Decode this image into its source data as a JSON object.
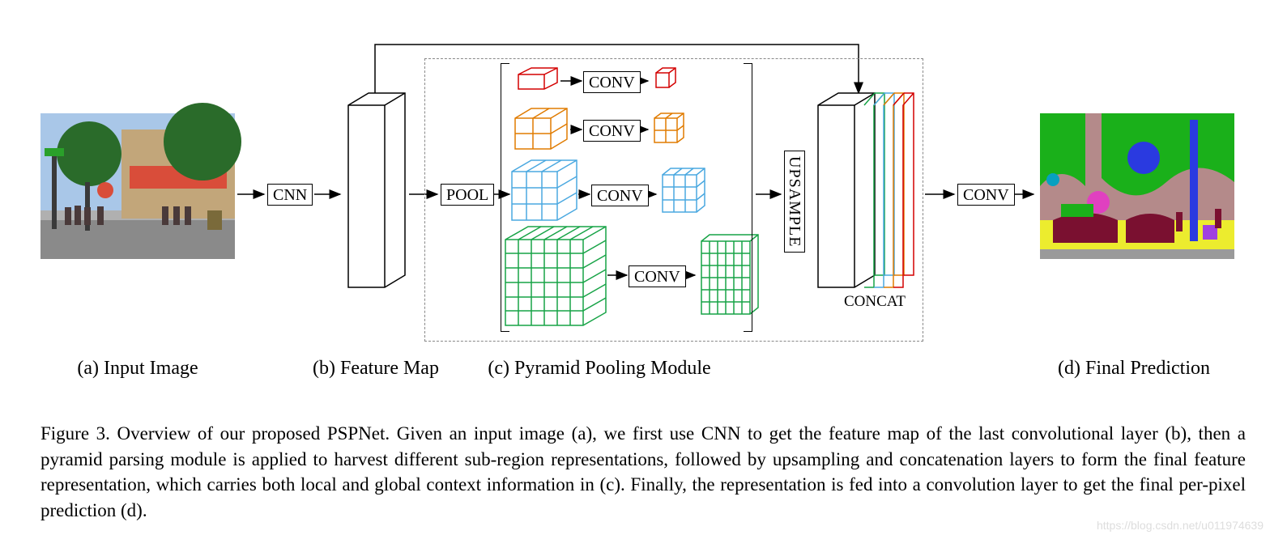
{
  "labels": {
    "a": "(a) Input Image",
    "b": "(b) Feature Map",
    "c": "(c) Pyramid Pooling Module",
    "d": "(d) Final Prediction"
  },
  "ops": {
    "cnn": "CNN",
    "pool": "POOL",
    "conv": "CONV",
    "upsample": "UPSAMPLE",
    "concat": "CONCAT"
  },
  "caption": "Figure 3. Overview of our proposed PSPNet. Given an input image (a), we first use CNN to get the feature map of the last convolutional layer (b), then a pyramid parsing module is applied to harvest different sub-region representations, followed by upsampling and concatenation layers to form the final feature representation, which carries both local and global context information in (c). Finally, the representation is fed into a convolution layer to get the final per-pixel prediction (d).",
  "watermark": "https://blog.csdn.net/u011974639",
  "pyramid": {
    "levels": [
      {
        "color": "#d40000",
        "grid": 1
      },
      {
        "color": "#e07b00",
        "grid": 2
      },
      {
        "color": "#4aa8e0",
        "grid": 3
      },
      {
        "color": "#17a346",
        "grid": 6
      }
    ]
  },
  "concat_colors": [
    "#000000",
    "#17a346",
    "#4aa8e0",
    "#e07b00",
    "#d40000"
  ]
}
